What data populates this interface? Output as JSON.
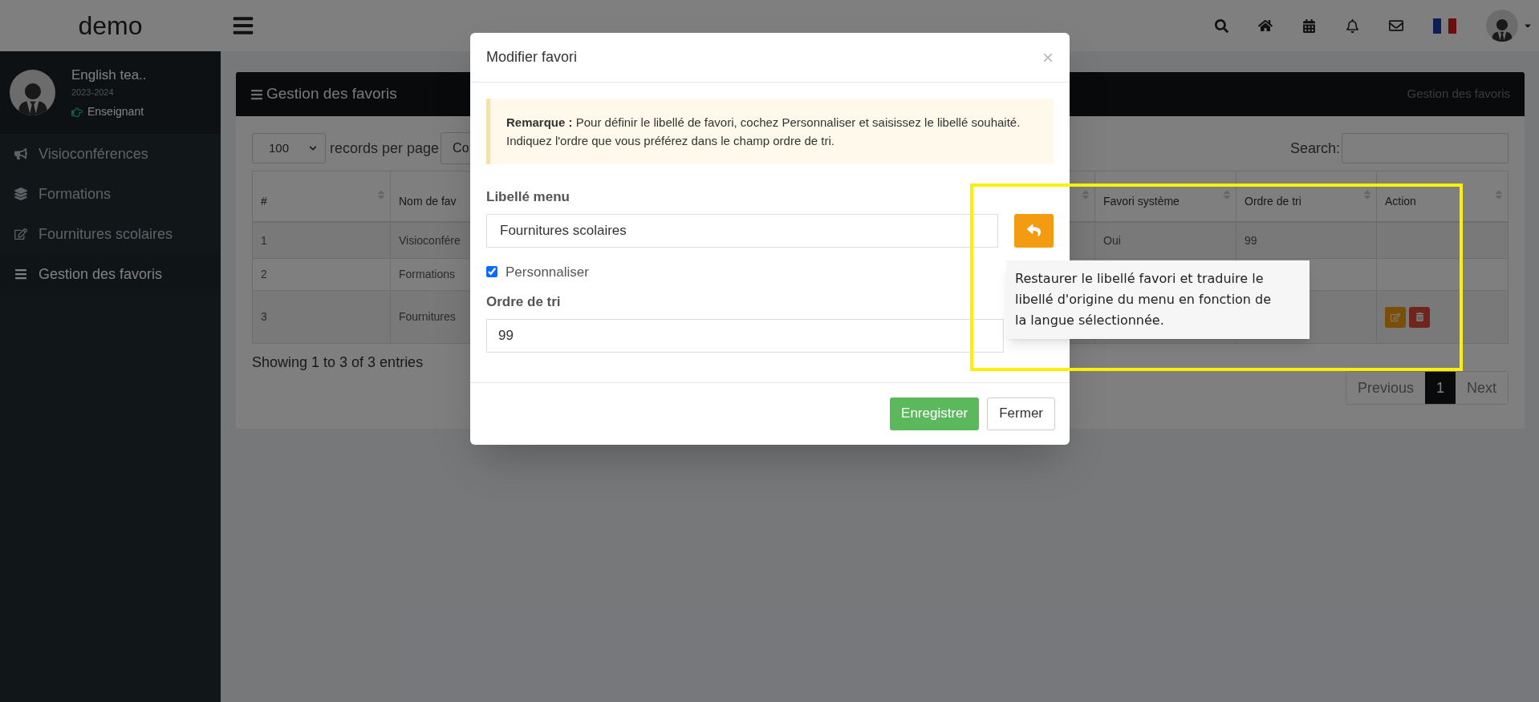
{
  "topbar": {
    "brand": "demo"
  },
  "sidebar": {
    "user": {
      "name": "English tea..",
      "year": "2023-2024",
      "role": "Enseignant"
    },
    "items": [
      {
        "label": "Visioconférences",
        "selected": false
      },
      {
        "label": "Formations",
        "selected": false
      },
      {
        "label": "Fournitures scolaires",
        "selected": false
      },
      {
        "label": "Gestion des favoris",
        "selected": true
      }
    ]
  },
  "page": {
    "title": "Gestion des favoris",
    "breadcrumb": "Gestion des favoris",
    "page_size": "100",
    "records_label": "records per page",
    "columns_button": "Co",
    "search_label": "Search:",
    "columns": [
      {
        "label": "#"
      },
      {
        "label": "Nom de fav"
      },
      {
        "label": "Favori système"
      },
      {
        "label": "Ordre de tri"
      },
      {
        "label": "Action"
      }
    ],
    "rows": [
      {
        "number": "1",
        "name": "Visioconfére",
        "system": "Oui",
        "order": "99",
        "actions": false
      },
      {
        "number": "2",
        "name": "Formations",
        "actions": false
      },
      {
        "number": "3",
        "name": "Fournitures",
        "actions": true
      }
    ],
    "info": "Showing 1 to 3 of 3 entries",
    "pagination": [
      {
        "label": "Previous",
        "selected": false
      },
      {
        "label": "1",
        "selected": true
      },
      {
        "label": "Next",
        "selected": false
      }
    ]
  },
  "modal": {
    "title": "Modifier favori",
    "close": "×",
    "note": "**Remarque :** Pour définir le libellé de favori, cochez Personnaliser et saisissez le libellé souhaité. Indiquez l'ordre que vous préférez dans le champ ordre de tri.",
    "label_field": {
      "label": "Libellé menu",
      "value": "Fournitures scolaires"
    },
    "customize": {
      "label": "Personnaliser",
      "checked": true
    },
    "order_field": {
      "label": "Ordre de tri",
      "value": "99"
    },
    "buttons": [
      {
        "label": "Enregistrer",
        "kind": "primary"
      },
      {
        "label": "Fermer",
        "kind": "default"
      }
    ]
  },
  "tooltip": "Restaurer le libellé favori et traduire le libellé d'origine du menu en fonction de la langue sélectionnée."
}
